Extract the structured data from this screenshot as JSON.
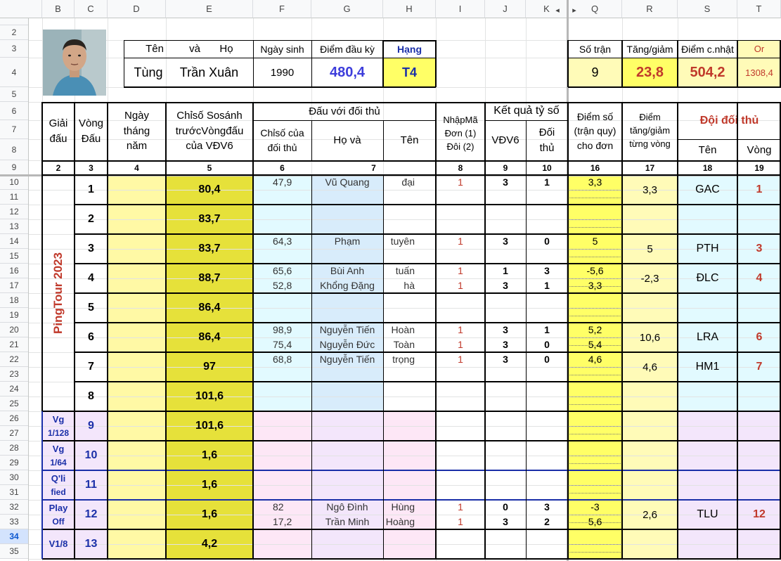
{
  "columns": [
    "B",
    "C",
    "D",
    "E",
    "F",
    "G",
    "H",
    "I",
    "J",
    "K",
    "Q",
    "R",
    "S",
    "T"
  ],
  "rows": [
    "2",
    "3",
    "4",
    "5",
    "6",
    "7",
    "8",
    "9",
    "10",
    "11",
    "12",
    "13",
    "14",
    "15",
    "16",
    "17",
    "18",
    "19",
    "20",
    "21",
    "22",
    "23",
    "24",
    "25",
    "26",
    "27",
    "28",
    "29",
    "30",
    "31",
    "32",
    "33",
    "34",
    "35"
  ],
  "profile": {
    "hdr_ten": "Tên",
    "hdr_va": "và",
    "hdr_ho": "Họ",
    "hdr_ngaysinh": "Ngày sinh",
    "hdr_diemdauky": "Điểm đầu kỳ",
    "hdr_hang": "Hạng",
    "ten": "Tùng",
    "hovaten": "Trần Xuân",
    "ngaysinh": "1990",
    "diemdauky": "480,4",
    "hang": "T4"
  },
  "summary": {
    "hdr_sotran": "Số trận",
    "hdr_tanggiam": "Tăng/giảm",
    "hdr_diemcnhat": "Điểm c.nhật",
    "hdr_or": "Or",
    "sotran": "9",
    "tanggiam": "23,8",
    "diemcnhat": "504,2",
    "or": "1308,4"
  },
  "headers": {
    "giaidau": [
      "Giải",
      "đấu"
    ],
    "vongdau": [
      "Vòng",
      "Đấu"
    ],
    "ngay": [
      "Ngày",
      "tháng",
      "năm"
    ],
    "chiso": [
      "Chỉsố Sosánh",
      "trướcVòngđấu",
      "của VĐV6"
    ],
    "dauvoi": "Đấu với đối thủ",
    "chisodoithu": [
      "Chỉsố của",
      "đối thủ"
    ],
    "hova": "Họ     và",
    "ten": "Tên",
    "nhapma": [
      "NhậpMã",
      "Đơn (1)",
      "Đôi (2)"
    ],
    "ketqua": "Kết quả tỷ số",
    "vdv6": "VĐV6",
    "doithu": [
      "Đối",
      "thủ"
    ],
    "diemso": [
      "Điểm số",
      "(trận quy)",
      "cho đơn"
    ],
    "diemtg": [
      "Điểm",
      "tăng/giảm",
      "từng vòng"
    ],
    "doidoithu": "Đội đối thủ",
    "doiten": "Tên",
    "doivong": "Vòng",
    "nums": [
      "2",
      "3",
      "4",
      "5",
      "6",
      "7",
      "8",
      "9",
      "10",
      "16",
      "17",
      "18",
      "19"
    ]
  },
  "tournament_label": "PingTour 2023",
  "stage_labels": [
    {
      "l1": "Vg",
      "l2": "1/128"
    },
    {
      "l1": "Vg",
      "l2": "1/64"
    },
    {
      "l1": "Q'li",
      "l2": "fied"
    },
    {
      "l1": "Play",
      "l2": "Off"
    },
    {
      "l1": "V1/8",
      "l2": ""
    }
  ],
  "rounds": [
    {
      "vong": "1",
      "chiso": "80,4",
      "diemtg": "3,3",
      "doi": "GAC",
      "doivong": "1",
      "lines": [
        {
          "cs": "47,9",
          "ho": "Vũ Quang",
          "ten": "đại",
          "ma": "1",
          "a": "3",
          "b": "1",
          "d": "3,3"
        }
      ]
    },
    {
      "vong": "2",
      "chiso": "83,7",
      "diemtg": "",
      "doi": "",
      "doivong": "",
      "lines": []
    },
    {
      "vong": "3",
      "chiso": "83,7",
      "diemtg": "5",
      "doi": "PTH",
      "doivong": "3",
      "lines": [
        {
          "cs": "64,3",
          "ho": "Phạm",
          "ten": "tuyên",
          "ma": "1",
          "a": "3",
          "b": "0",
          "d": "5"
        }
      ]
    },
    {
      "vong": "4",
      "chiso": "88,7",
      "diemtg": "-2,3",
      "doi": "ĐLC",
      "doivong": "4",
      "lines": [
        {
          "cs": "65,6",
          "ho": "Bùi Anh",
          "ten": "tuấn",
          "ma": "1",
          "a": "1",
          "b": "3",
          "d": "-5,6"
        },
        {
          "cs": "52,8",
          "ho": "Khổng Đặng",
          "ten": "hà",
          "ma": "1",
          "a": "3",
          "b": "1",
          "d": "3,3"
        }
      ]
    },
    {
      "vong": "5",
      "chiso": "86,4",
      "diemtg": "",
      "doi": "",
      "doivong": "",
      "lines": []
    },
    {
      "vong": "6",
      "chiso": "86,4",
      "diemtg": "10,6",
      "doi": "LRA",
      "doivong": "6",
      "lines": [
        {
          "cs": "98,9",
          "ho": "Nguyễn Tiến",
          "ten": "Hoàn",
          "ma": "1",
          "a": "3",
          "b": "1",
          "d": "5,2"
        },
        {
          "cs": "75,4",
          "ho": "Nguyễn Đức",
          "ten": "Toàn",
          "ma": "1",
          "a": "3",
          "b": "0",
          "d": "5,4"
        }
      ]
    },
    {
      "vong": "7",
      "chiso": "97",
      "diemtg": "4,6",
      "doi": "HM1",
      "doivong": "7",
      "lines": [
        {
          "cs": "68,8",
          "ho": "Nguyễn Tiến",
          "ten": "trọng",
          "ma": "1",
          "a": "3",
          "b": "0",
          "d": "4,6"
        }
      ]
    },
    {
      "vong": "8",
      "chiso": "101,6",
      "diemtg": "",
      "doi": "",
      "doivong": "",
      "lines": []
    },
    {
      "vong": "9",
      "chiso": "101,6",
      "diemtg": "",
      "doi": "",
      "doivong": "",
      "lines": []
    },
    {
      "vong": "10",
      "chiso": "1,6",
      "diemtg": "",
      "doi": "",
      "doivong": "",
      "lines": []
    },
    {
      "vong": "11",
      "chiso": "1,6",
      "diemtg": "",
      "doi": "",
      "doivong": "",
      "lines": []
    },
    {
      "vong": "12",
      "chiso": "1,6",
      "diemtg": "2,6",
      "doi": "TLU",
      "doivong": "12",
      "lines": [
        {
          "cs": "82",
          "ho": "Ngô Đình",
          "ten": "Hùng",
          "ma": "1",
          "a": "0",
          "b": "3",
          "d": "-3"
        },
        {
          "cs": "17,2",
          "ho": "Trần Minh",
          "ten": "Hoàng",
          "ma": "1",
          "a": "3",
          "b": "2",
          "d": "5,6"
        }
      ]
    },
    {
      "vong": "13",
      "chiso": "4,2",
      "diemtg": "",
      "doi": "",
      "doivong": "",
      "lines": []
    }
  ],
  "colors": {
    "yellow": "#ffff66",
    "olive": "#e6e13a",
    "cream": "#fffbb8",
    "lightyellow": "#fff9a5",
    "cyan": "#e2faff",
    "pink": "#fde7f6",
    "name_blue": "#d8ecfb",
    "lavender": "#f3e6fb",
    "red": "#c0392b",
    "blue": "#3d3ddb",
    "darkblue": "#1a2fa8"
  }
}
